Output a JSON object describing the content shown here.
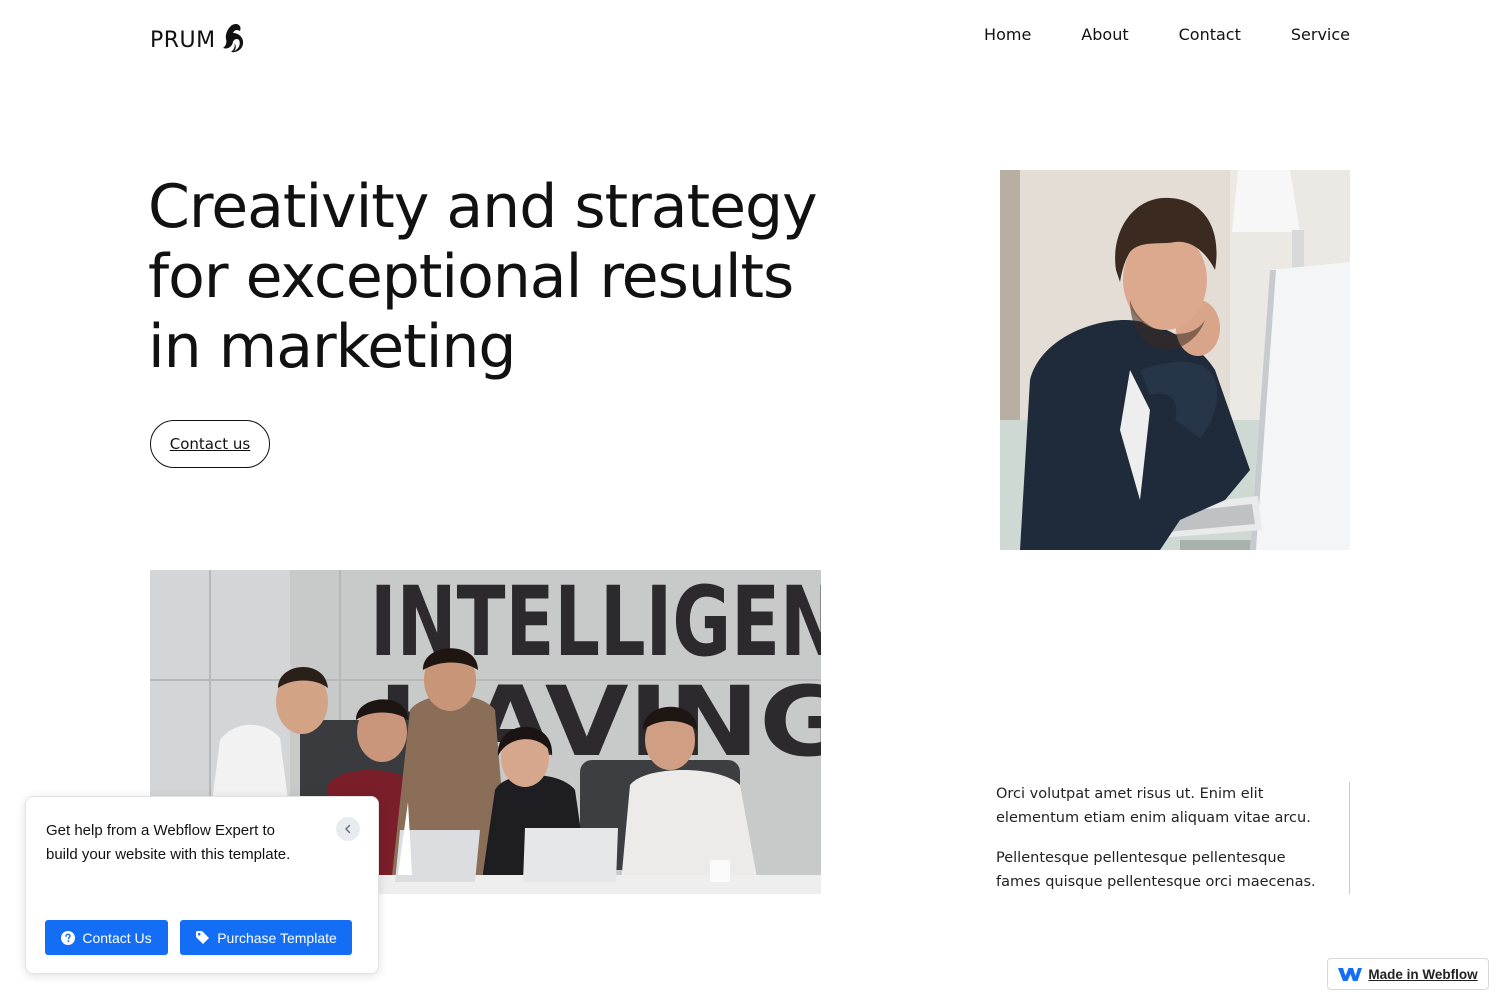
{
  "brand": {
    "name": "PRUM"
  },
  "nav": {
    "home": "Home",
    "about": "About",
    "contact": "Contact",
    "service": "Service"
  },
  "hero": {
    "title_lines": [
      "Creativity and strategy",
      "for exceptional results",
      "in marketing"
    ],
    "cta_label": "Contact us"
  },
  "side_text": {
    "paragraph_1": "Orci volutpat amet risus ut. Enim elit elementum etiam enim aliquam vitae arcu.",
    "paragraph_2": "Pellentesque pellentesque pellentesque fames quisque pellentesque orci maecenas."
  },
  "images": {
    "team_wall_text_line_1": "INTELLIGEN",
    "team_wall_text_line_2": "HAVING"
  },
  "help_popup": {
    "text": "Get help from a Webflow Expert to build your website with this template.",
    "contact_label": "Contact Us",
    "purchase_label": "Purchase Template"
  },
  "badge": {
    "label": "Made in Webflow"
  },
  "colors": {
    "accent": "#146ef5",
    "text": "#111111",
    "background": "#ffffff"
  },
  "icons": [
    "logo-flame-icon",
    "close-chevron-icon",
    "question-circle-icon",
    "tag-icon",
    "webflow-icon"
  ]
}
